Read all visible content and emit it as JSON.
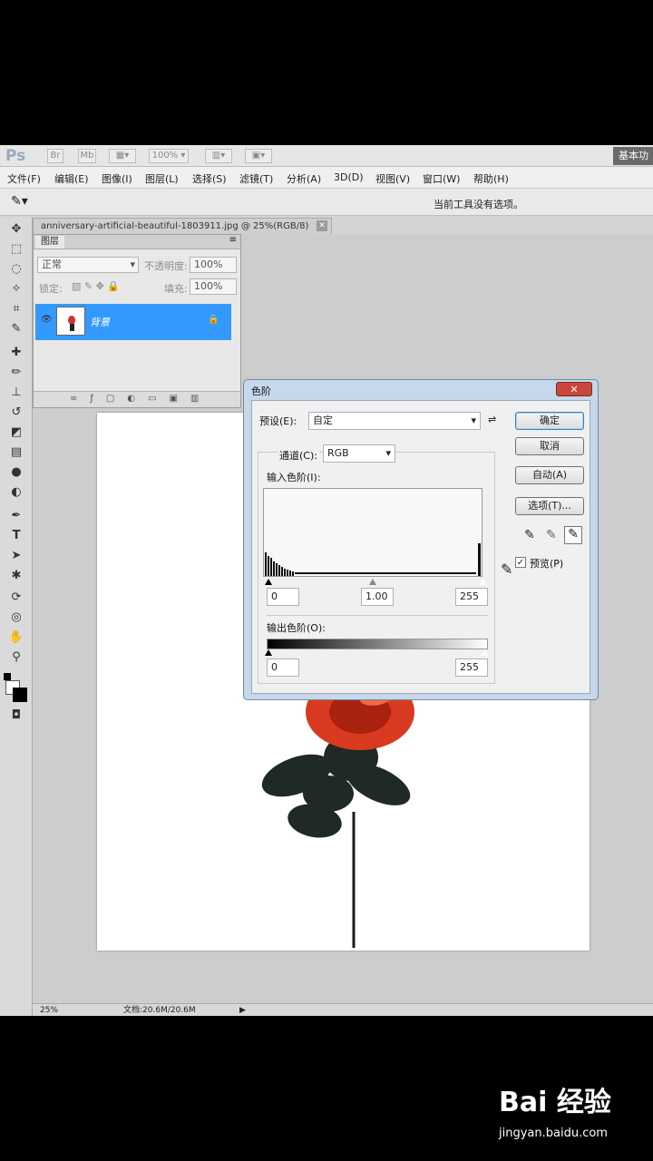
{
  "app": {
    "logo": "Ps",
    "zoom": "100%",
    "workspace": "基本功"
  },
  "menu": [
    "文件(F)",
    "编辑(E)",
    "图像(I)",
    "图层(L)",
    "选择(S)",
    "滤镜(T)",
    "分析(A)",
    "3D(D)",
    "视图(V)",
    "窗口(W)",
    "帮助(H)"
  ],
  "options_bar": {
    "message": "当前工具没有选项。"
  },
  "document_tab": {
    "title": "anniversary-artificial-beautiful-1803911.jpg @ 25%(RGB/8)",
    "close": "✕"
  },
  "layers_panel": {
    "tab": "图层",
    "blend_mode": "正常",
    "opacity_label": "不透明度:",
    "opacity_value": "100%",
    "lock_label": "锁定:",
    "fill_label": "填充:",
    "fill_value": "100%",
    "layer_name": "背景"
  },
  "levels_dialog": {
    "title": "色阶",
    "close": "✕",
    "preset_label": "预设(E):",
    "preset_value": "自定",
    "channel_label": "通道(C):",
    "channel_value": "RGB",
    "input_label": "输入色阶(I):",
    "input_black": "0",
    "input_gamma": "1.00",
    "input_white": "255",
    "output_label": "输出色阶(O):",
    "output_black": "0",
    "output_white": "255",
    "buttons": {
      "ok": "确定",
      "cancel": "取消",
      "auto": "自动(A)",
      "options": "选项(T)..."
    },
    "preview_label": "预览(P)",
    "preview_checked": true
  },
  "status_bar": {
    "zoom": "25%",
    "doc_info": "文档:20.6M/20.6M"
  },
  "watermark": {
    "brand": "Bai 经验",
    "url": "jingyan.baidu.com"
  }
}
